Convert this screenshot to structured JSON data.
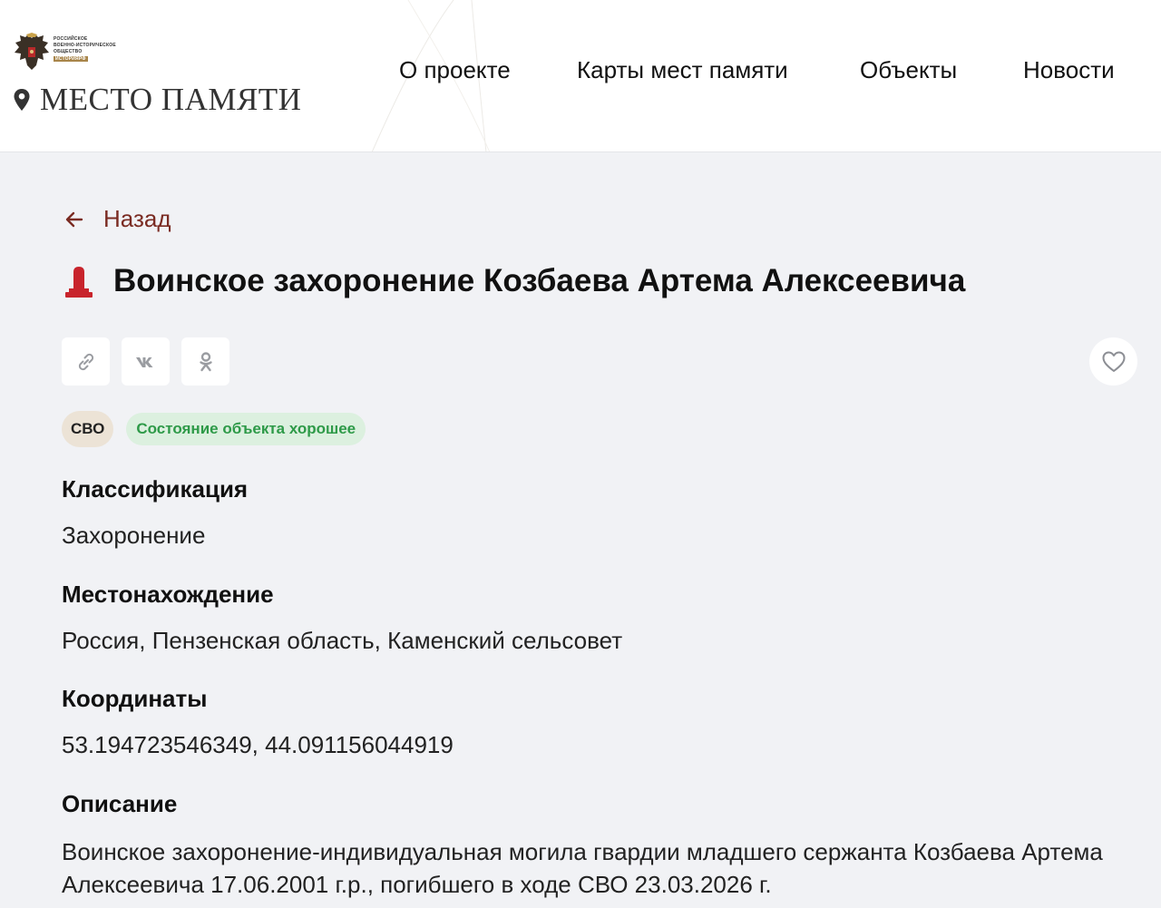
{
  "logo": {
    "caption_lines": [
      "Российское",
      "военно-историческое",
      "общество"
    ],
    "caption_tag": "историярф",
    "name": "МЕСТО ПАМЯТИ",
    "emblem_icon": "double-headed-eagle-icon",
    "pin_icon": "map-pin-icon"
  },
  "nav": {
    "items": [
      {
        "label": "О проекте"
      },
      {
        "label": "Карты мест памяти"
      },
      {
        "label": "Объекты"
      },
      {
        "label": "Новости"
      }
    ]
  },
  "back": {
    "label": "Назад",
    "icon": "arrow-left-icon"
  },
  "object": {
    "icon": "grave-monument-icon",
    "title": "Воинское захоронение Козбаева Артема Алексеевича"
  },
  "share": {
    "buttons": [
      {
        "icon": "link-icon"
      },
      {
        "icon": "vk-icon"
      },
      {
        "icon": "odnoklassniki-icon"
      }
    ],
    "favorite_icon": "heart-icon"
  },
  "tags": {
    "category": "СВО",
    "state": "Состояние объекта хорошее"
  },
  "fields": {
    "classification_label": "Классификация",
    "classification_value": "Захоронение",
    "location_label": "Местонахождение",
    "location_value": "Россия, Пензенская область, Каменский сельсовет",
    "coordinates_label": "Координаты",
    "coordinates_value": "53.194723546349, 44.091156044919",
    "description_label": "Описание",
    "description_value": "Воинское захоронение-индивидуальная могила гвардии младшего сержанта Козбаева Артема Алексеевича 17.06.2001 г.р., погибшего в ходе СВО 23.03.2026 г."
  },
  "colors": {
    "accent": "#7a2b22",
    "monument": "#c8242c",
    "state_text": "#2e9a48",
    "state_bg": "#dcf0df",
    "svo_bg": "#ece3d6",
    "page_bg": "#f1f2f5"
  }
}
